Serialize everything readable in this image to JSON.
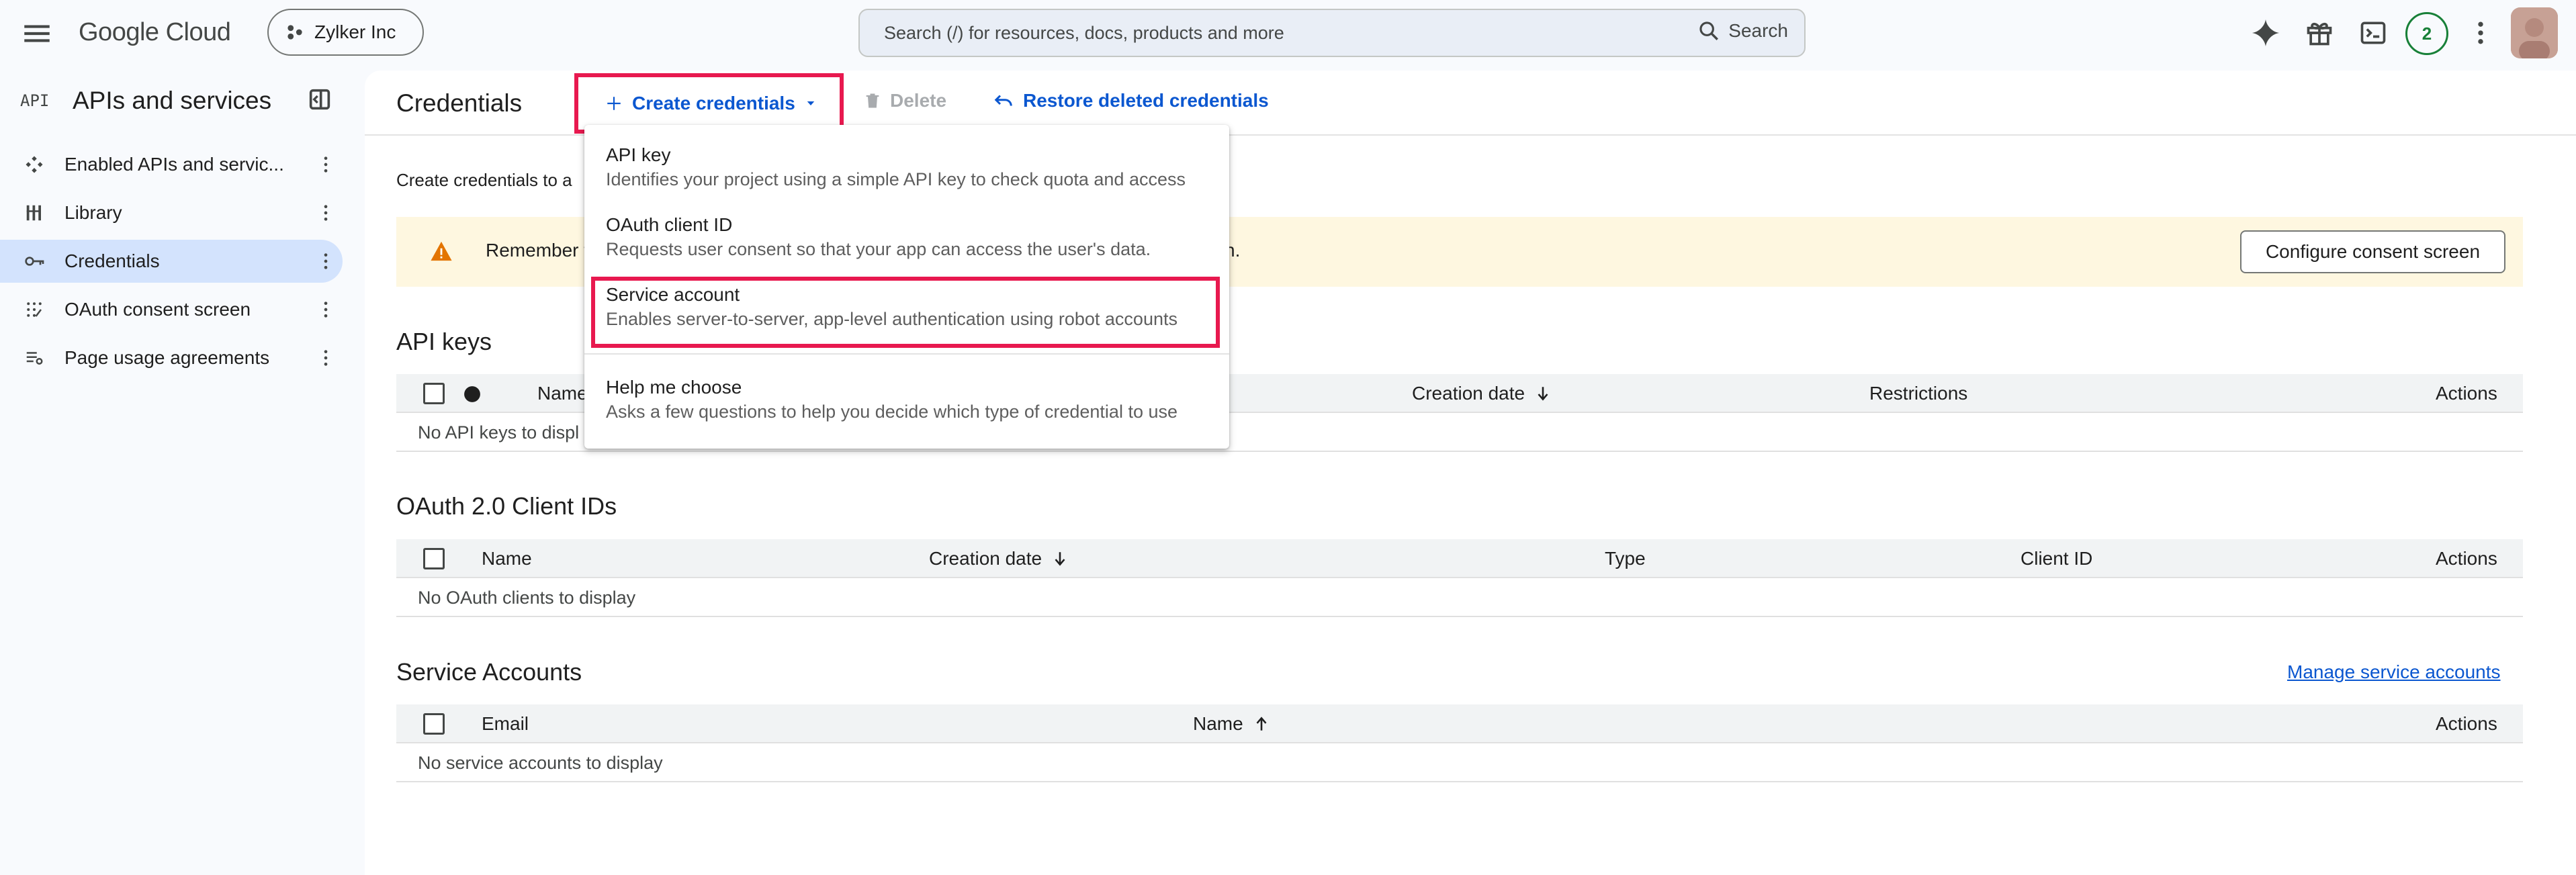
{
  "header": {
    "logo_text": "Google Cloud",
    "project": "Zylker Inc",
    "search_placeholder": "Search (/) for resources, docs, products and more",
    "search_button": "Search",
    "notifications_count": "2"
  },
  "sidebar": {
    "api_badge": "API",
    "title": "APIs and services",
    "items": [
      {
        "label": "Enabled APIs and servic...",
        "icon": "enabled-apis-icon",
        "active": false
      },
      {
        "label": "Library",
        "icon": "library-icon",
        "active": false
      },
      {
        "label": "Credentials",
        "icon": "key-icon",
        "active": true
      },
      {
        "label": "OAuth consent screen",
        "icon": "consent-icon",
        "active": false
      },
      {
        "label": "Page usage agreements",
        "icon": "agreements-icon",
        "active": false
      }
    ]
  },
  "toolbar": {
    "page_title": "Credentials",
    "create_label": "Create credentials",
    "delete_label": "Delete",
    "restore_label": "Restore deleted credentials"
  },
  "main": {
    "intro_text": "Create credentials to a",
    "warning_text_start": "Remember t",
    "warning_text_end": "n.",
    "consent_button": "Configure consent screen"
  },
  "api_keys": {
    "title": "API keys",
    "columns": [
      "Name",
      "Creation date",
      "Restrictions",
      "Actions"
    ],
    "empty": "No API keys to displ"
  },
  "oauth": {
    "title": "OAuth 2.0 Client IDs",
    "columns": [
      "Name",
      "Creation date",
      "Type",
      "Client ID",
      "Actions"
    ],
    "empty": "No OAuth clients to display"
  },
  "service_accounts": {
    "title": "Service Accounts",
    "manage_link": "Manage service accounts",
    "columns": [
      "Email",
      "Name",
      "Actions"
    ],
    "empty": "No service accounts to display"
  },
  "dropdown": {
    "items": [
      {
        "title": "API key",
        "subtitle": "Identifies your project using a simple API key to check quota and access"
      },
      {
        "title": "OAuth client ID",
        "subtitle": "Requests user consent so that your app can access the user's data."
      },
      {
        "title": "Service account",
        "subtitle": "Enables server-to-server, app-level authentication using robot accounts"
      },
      {
        "title": "Help me choose",
        "subtitle": "Asks a few questions to help you decide which type of credential to use"
      }
    ]
  },
  "colors": {
    "accent": "#0b57d0",
    "highlight": "#e8194f",
    "warning": "#e37400",
    "active_nav": "#d3e3fd"
  }
}
